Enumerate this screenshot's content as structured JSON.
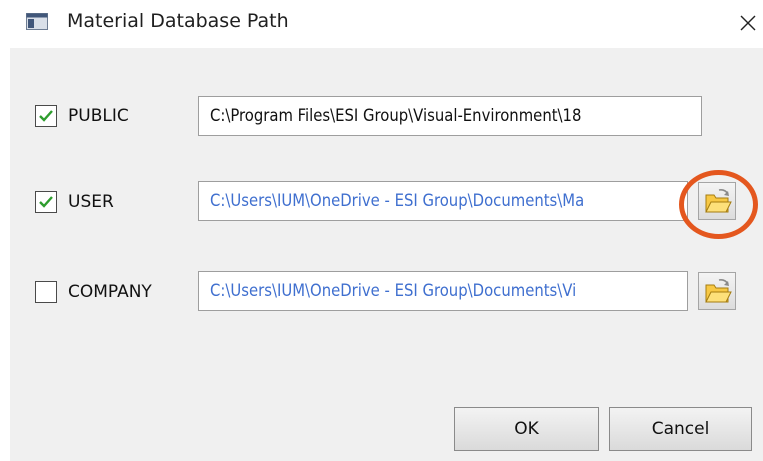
{
  "window": {
    "title": "Material Database Path",
    "close_glyph": "×"
  },
  "rows": [
    {
      "label": "PUBLIC",
      "checked": true,
      "path": "C:\\Program Files\\ESI Group\\Visual-Environment\\18",
      "path_color": "#111111",
      "has_browse": false
    },
    {
      "label": "USER",
      "checked": true,
      "path": "C:\\Users\\IUM\\OneDrive - ESI Group\\Documents\\Ma",
      "path_color": "#3f6fcf",
      "has_browse": true,
      "browse_icon": "open-folder-icon",
      "highlighted": true
    },
    {
      "label": "COMPANY",
      "checked": false,
      "path": "C:\\Users\\IUM\\OneDrive - ESI Group\\Documents\\Vi",
      "path_color": "#3f6fcf",
      "has_browse": true,
      "browse_icon": "open-folder-icon"
    }
  ],
  "buttons": {
    "ok": "OK",
    "cancel": "Cancel"
  },
  "colors": {
    "checkmark": "#2e9d2e",
    "highlight_ring": "#e4571e",
    "dialog_bg": "#f0f0f0"
  }
}
